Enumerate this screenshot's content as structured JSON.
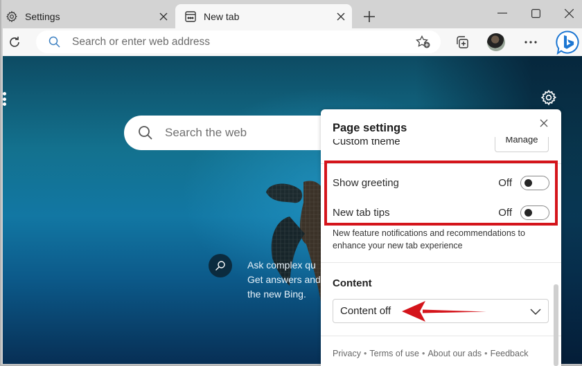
{
  "browser": {
    "tabs": [
      {
        "label": "Settings",
        "icon": "gear-icon",
        "active": false
      },
      {
        "label": "New tab",
        "icon": "newtab-page-icon",
        "active": true
      }
    ],
    "address_bar": {
      "placeholder": "Search or enter web address"
    },
    "toolbar_icons": [
      "refresh-icon",
      "favorites-add-icon",
      "collections-icon",
      "profile-avatar",
      "more-icon",
      "bing-chat-icon"
    ],
    "window_controls": [
      "minimize",
      "maximize",
      "close"
    ]
  },
  "newtab": {
    "search_placeholder": "Search the web",
    "bing_promo": [
      "Ask complex qu",
      "Get answers and",
      "the new Bing."
    ]
  },
  "page_settings": {
    "title": "Page settings",
    "custom_theme_label": "Custom theme",
    "manage_label": "Manage",
    "toggles": [
      {
        "label": "Show greeting",
        "state": "Off",
        "on": false
      },
      {
        "label": "New tab tips",
        "state": "Off",
        "on": false
      }
    ],
    "tips_description": "New feature notifications and recommendations to enhance your new tab experience",
    "content_heading": "Content",
    "content_select": {
      "value": "Content off"
    },
    "footer_links": [
      "Privacy",
      "Terms of use",
      "About our ads",
      "Feedback"
    ]
  },
  "annotation": {
    "highlight_color": "#d4141b",
    "arrow_color": "#d4141b"
  }
}
